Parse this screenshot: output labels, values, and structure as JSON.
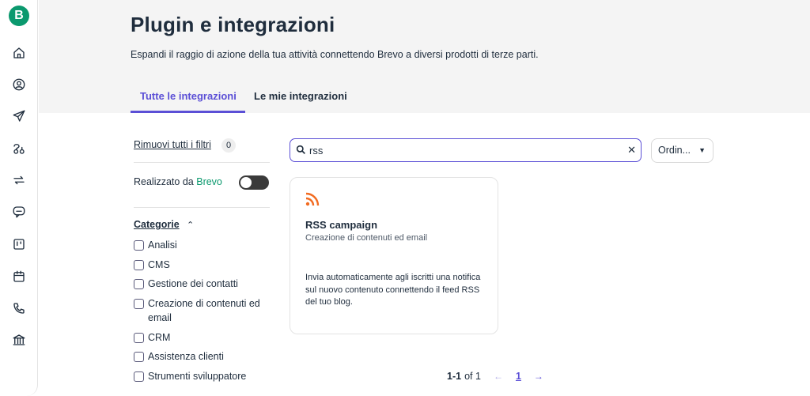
{
  "rail": {
    "logo_letter": "B",
    "icons": [
      "home-icon",
      "contacts-icon",
      "campaigns-icon",
      "automations-icon",
      "transactional-icon",
      "conversations-icon",
      "deals-icon",
      "meetings-icon",
      "phone-icon",
      "bank-icon"
    ]
  },
  "header": {
    "title": "Plugin e integrazioni",
    "subtitle": "Espandi il raggio di azione della tua attività connettendo Brevo a diversi prodotti di terze parti.",
    "tabs": [
      {
        "label": "Tutte le integrazioni",
        "active": true
      },
      {
        "label": "Le mie integrazioni",
        "active": false
      }
    ]
  },
  "filters": {
    "remove_all_label": "Rimuovi tutti i filtri",
    "count": "0",
    "made_by_label": "Realizzato da",
    "made_by_brand": "Brevo",
    "made_by_enabled": false,
    "categories_label": "Categorie",
    "categories": [
      {
        "label": "Analisi",
        "checked": false
      },
      {
        "label": "CMS",
        "checked": false
      },
      {
        "label": "Gestione dei contatti",
        "checked": false
      },
      {
        "label": "Creazione di contenuti ed email",
        "checked": false
      },
      {
        "label": "CRM",
        "checked": false
      },
      {
        "label": "Assistenza clienti",
        "checked": false
      },
      {
        "label": "Strumenti sviluppatore",
        "checked": false
      }
    ]
  },
  "search": {
    "value": "rss",
    "sort_label": "Ordin..."
  },
  "results": [
    {
      "icon": "rss-icon",
      "title": "RSS campaign",
      "category": "Creazione di contenuti ed email",
      "description": "Invia automaticamente agli iscritti una notifica sul nuovo contenuto connettendo il feed RSS del tuo blog."
    }
  ],
  "pagination": {
    "range": "1-1",
    "of_label": "of 1",
    "current_page": "1"
  },
  "colors": {
    "accent": "#5b4fd6",
    "brand": "#0b996e",
    "rss": "#f26b21"
  }
}
